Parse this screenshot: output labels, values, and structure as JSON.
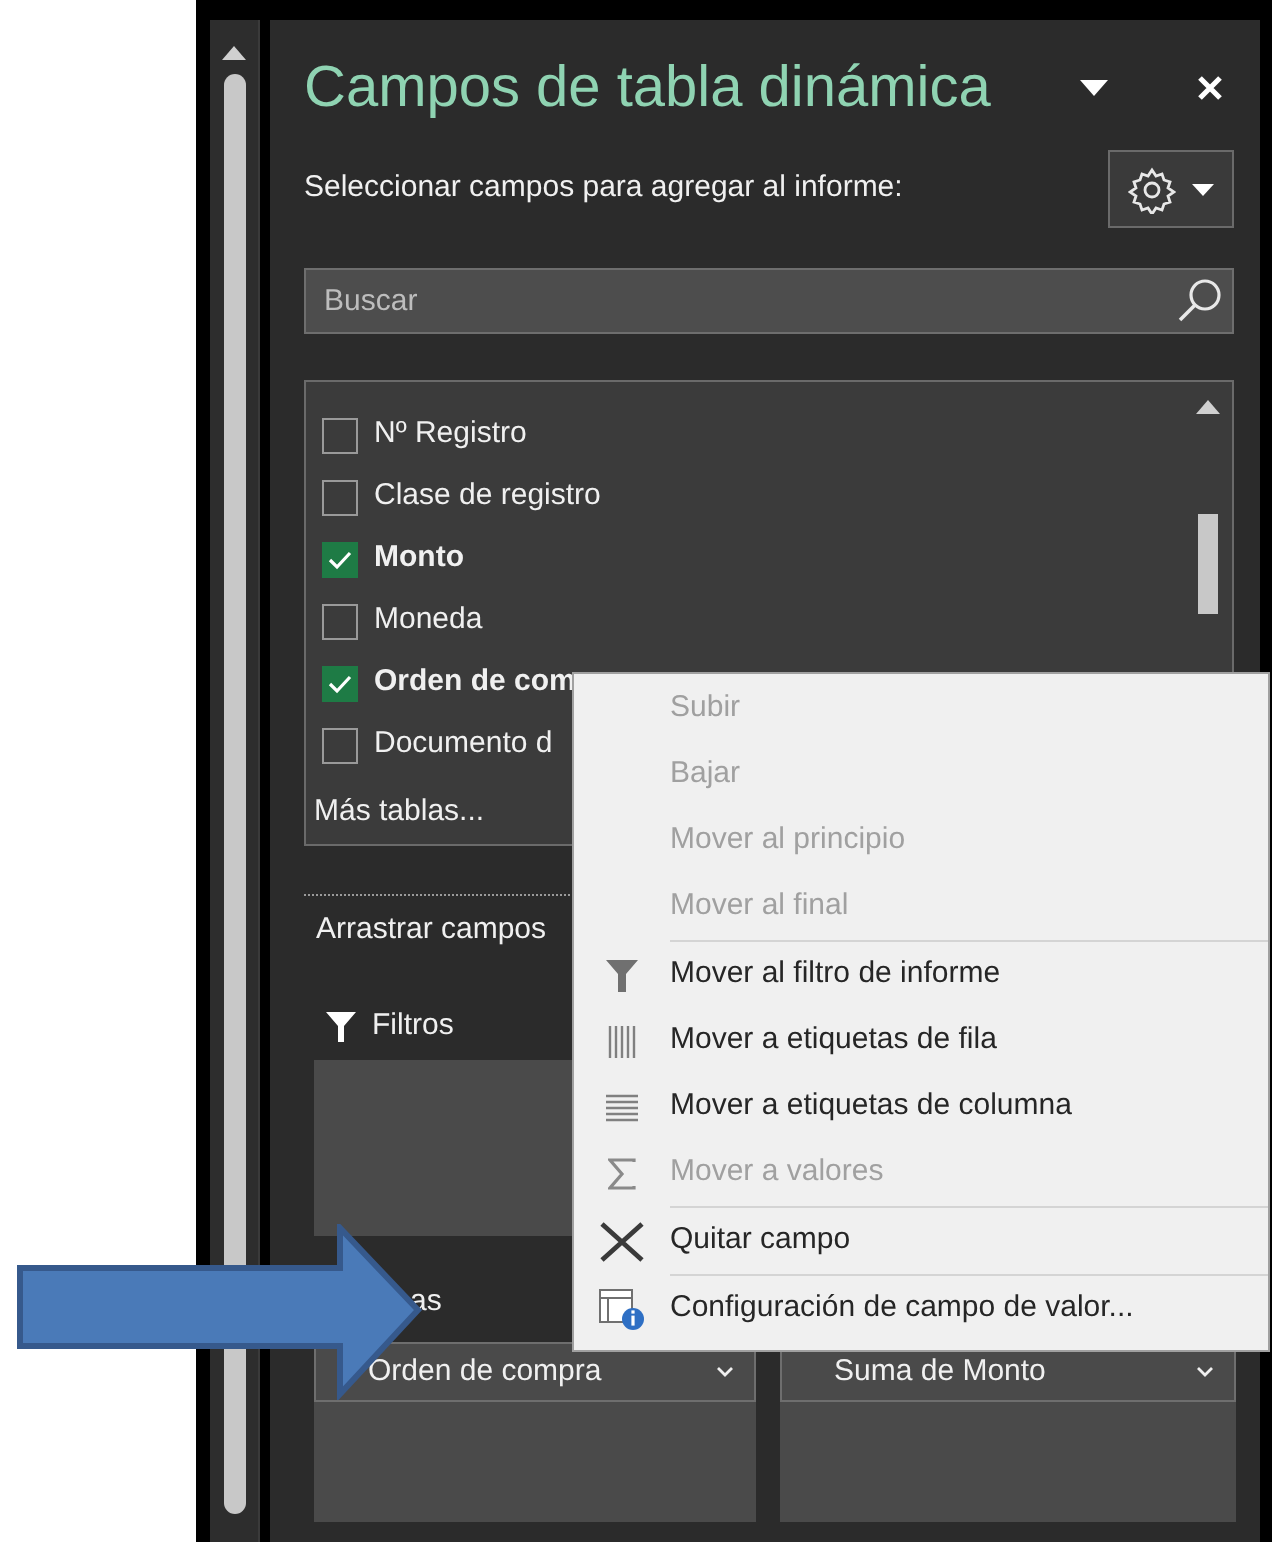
{
  "panel": {
    "title": "Campos de tabla dinámica",
    "subtitle": "Seleccionar campos para agregar al informe:",
    "search": {
      "placeholder": "Buscar"
    },
    "fields": [
      {
        "label": "Nº Registro",
        "checked": false
      },
      {
        "label": "Clase de registro",
        "checked": false
      },
      {
        "label": "Monto",
        "checked": true
      },
      {
        "label": "Moneda",
        "checked": false
      },
      {
        "label": "Orden de com",
        "checked": true
      },
      {
        "label": "Documento d",
        "checked": false
      }
    ],
    "more_tables": "Más tablas...",
    "drag_label": "Arrastrar campos",
    "areas": {
      "filters": {
        "label": "Filtros"
      },
      "rows": {
        "label": "as",
        "items": [
          "Orden de compra"
        ]
      },
      "values": {
        "items": [
          "Suma de Monto"
        ]
      }
    }
  },
  "context_menu": {
    "items": [
      {
        "label": "Subir",
        "disabled": true,
        "kind": "plain",
        "separator_before": false
      },
      {
        "label": "Bajar",
        "disabled": true,
        "kind": "plain",
        "separator_before": false
      },
      {
        "label": "Mover al principio",
        "disabled": true,
        "kind": "plain",
        "separator_before": false
      },
      {
        "label": "Mover al final",
        "disabled": true,
        "kind": "plain",
        "separator_before": false
      },
      {
        "label": "Mover al filtro de informe",
        "disabled": false,
        "kind": "filter",
        "separator_before": true
      },
      {
        "label": "Mover a etiquetas de fila",
        "disabled": false,
        "kind": "rows",
        "separator_before": false
      },
      {
        "label": "Mover a etiquetas de columna",
        "disabled": false,
        "kind": "columns",
        "separator_before": false
      },
      {
        "label": "Mover a valores",
        "disabled": true,
        "kind": "sum",
        "separator_before": false
      },
      {
        "label": "Quitar campo",
        "disabled": false,
        "kind": "remove",
        "separator_before": true
      },
      {
        "label": "Configuración de campo de valor...",
        "disabled": false,
        "kind": "settings",
        "separator_before": true
      }
    ]
  }
}
